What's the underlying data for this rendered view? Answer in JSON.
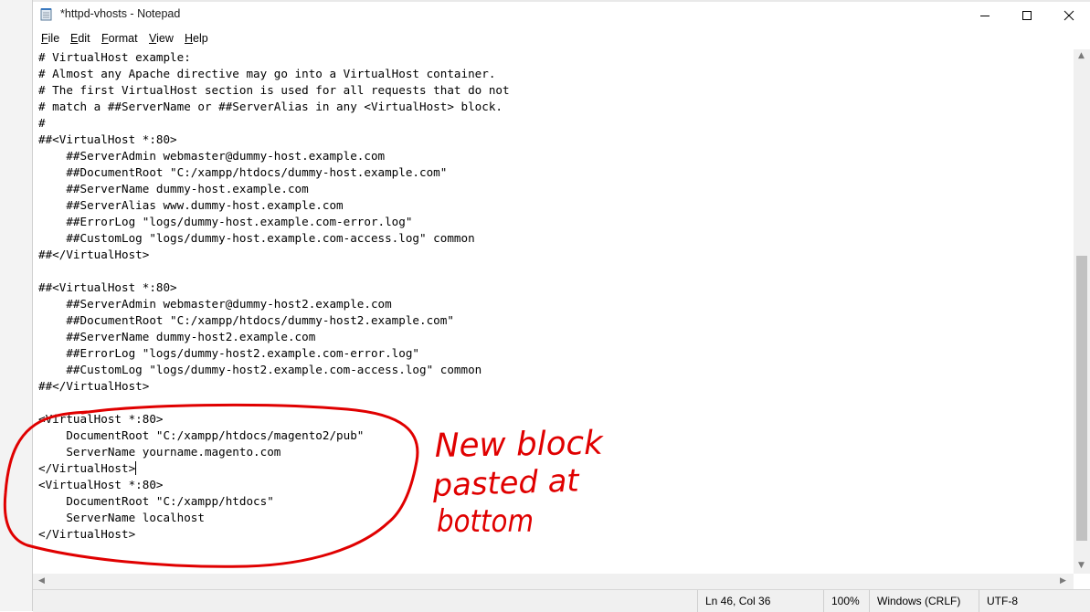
{
  "window": {
    "title": "*httpd-vhosts - Notepad",
    "icon": "notepad-icon",
    "controls": [
      "minimize-icon",
      "maximize-icon",
      "close-icon"
    ]
  },
  "menu": {
    "items": [
      {
        "mnemonic": "F",
        "rest": "ile"
      },
      {
        "mnemonic": "E",
        "rest": "dit"
      },
      {
        "mnemonic": "F",
        "rest": "ormat"
      },
      {
        "mnemonic": "V",
        "rest": "iew"
      },
      {
        "mnemonic": "H",
        "rest": "elp"
      }
    ]
  },
  "editor": {
    "lines": [
      "# VirtualHost example:",
      "# Almost any Apache directive may go into a VirtualHost container.",
      "# The first VirtualHost section is used for all requests that do not",
      "# match a ##ServerName or ##ServerAlias in any <VirtualHost> block.",
      "#",
      "##<VirtualHost *:80>",
      "    ##ServerAdmin webmaster@dummy-host.example.com",
      "    ##DocumentRoot \"C:/xampp/htdocs/dummy-host.example.com\"",
      "    ##ServerName dummy-host.example.com",
      "    ##ServerAlias www.dummy-host.example.com",
      "    ##ErrorLog \"logs/dummy-host.example.com-error.log\"",
      "    ##CustomLog \"logs/dummy-host.example.com-access.log\" common",
      "##</VirtualHost>",
      "",
      "##<VirtualHost *:80>",
      "    ##ServerAdmin webmaster@dummy-host2.example.com",
      "    ##DocumentRoot \"C:/xampp/htdocs/dummy-host2.example.com\"",
      "    ##ServerName dummy-host2.example.com",
      "    ##ErrorLog \"logs/dummy-host2.example.com-error.log\"",
      "    ##CustomLog \"logs/dummy-host2.example.com-access.log\" common",
      "##</VirtualHost>",
      "",
      "<VirtualHost *:80>",
      "    DocumentRoot \"C:/xampp/htdocs/magento2/pub\"",
      "    ServerName yourname.magento.com",
      "</VirtualHost>",
      "<VirtualHost *:80>",
      "    DocumentRoot \"C:/xampp/htdocs\"",
      "    ServerName localhost",
      "</VirtualHost>"
    ],
    "caret_line": 25
  },
  "statusbar": {
    "position": "Ln 46, Col 36",
    "zoom": "100%",
    "line_endings": "Windows (CRLF)",
    "encoding": "UTF-8"
  },
  "annotation": {
    "color": "#e00000",
    "lines": [
      "New block",
      "pasted at",
      "bottom"
    ]
  }
}
